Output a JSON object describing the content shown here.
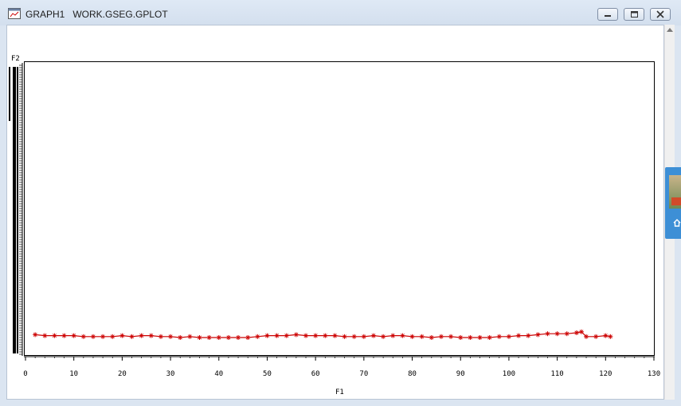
{
  "window": {
    "title": "GRAPH1   WORK.GSEG.GPLOT",
    "controls": {
      "minimize": "minimize-icon",
      "maximize": "maximize-icon",
      "close": "close-icon"
    }
  },
  "chart_data": {
    "type": "line",
    "xlabel": "F1",
    "ylabel": "F2",
    "xlim": [
      0,
      130
    ],
    "x_ticks": [
      "0",
      "10",
      "20",
      "30",
      "40",
      "50",
      "60",
      "70",
      "80",
      "90",
      "100",
      "110",
      "120",
      "130"
    ],
    "marker": "star",
    "color": "#cc0000",
    "series": [
      {
        "x": [
          2,
          4,
          6,
          8,
          10,
          12,
          14,
          16,
          18,
          20,
          22,
          24,
          26,
          28,
          30,
          32,
          34,
          36,
          38,
          40,
          42,
          44,
          46,
          48,
          50,
          52,
          54,
          56,
          58,
          60,
          62,
          64,
          66,
          68,
          70,
          72,
          74,
          76,
          78,
          80,
          82,
          84,
          86,
          88,
          90,
          92,
          94,
          96,
          98,
          100,
          102,
          104,
          106,
          108,
          110,
          112,
          114,
          115,
          116,
          118,
          120,
          121
        ],
        "y": [
          0.52,
          0.42,
          0.42,
          0.42,
          0.42,
          0.32,
          0.32,
          0.32,
          0.32,
          0.42,
          0.32,
          0.42,
          0.42,
          0.32,
          0.32,
          0.22,
          0.32,
          0.22,
          0.22,
          0.22,
          0.22,
          0.22,
          0.22,
          0.32,
          0.42,
          0.42,
          0.42,
          0.52,
          0.42,
          0.42,
          0.42,
          0.42,
          0.32,
          0.32,
          0.32,
          0.42,
          0.32,
          0.42,
          0.42,
          0.32,
          0.32,
          0.22,
          0.32,
          0.32,
          0.22,
          0.22,
          0.22,
          0.22,
          0.32,
          0.32,
          0.42,
          0.42,
          0.52,
          0.62,
          0.62,
          0.62,
          0.72,
          0.82,
          0.32,
          0.32,
          0.42,
          0.32
        ]
      }
    ]
  }
}
